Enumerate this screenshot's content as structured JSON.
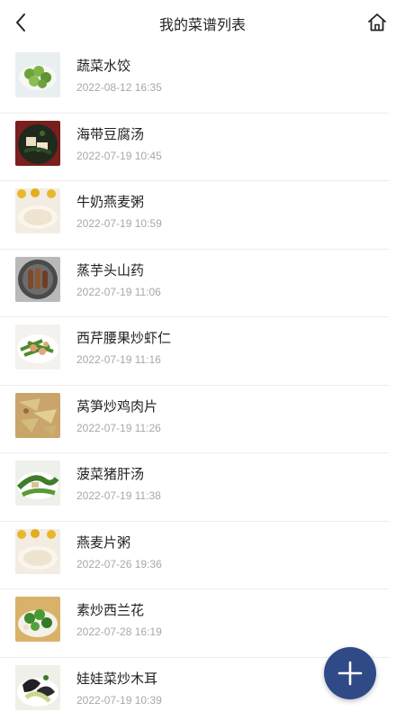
{
  "header": {
    "title": "我的菜谱列表",
    "back_icon": "chevron-left-icon",
    "home_icon": "home-icon"
  },
  "recipes": [
    {
      "name": "蔬菜水饺",
      "time": "2022-08-12 16:35"
    },
    {
      "name": "海带豆腐汤",
      "time": "2022-07-19 10:45"
    },
    {
      "name": "牛奶燕麦粥",
      "time": "2022-07-19 10:59"
    },
    {
      "name": "蒸芋头山药",
      "time": "2022-07-19 11:06"
    },
    {
      "name": "西芹腰果炒虾仁",
      "time": "2022-07-19 11:16"
    },
    {
      "name": "莴笋炒鸡肉片",
      "time": "2022-07-19 11:26"
    },
    {
      "name": "菠菜猪肝汤",
      "time": "2022-07-19 11:38"
    },
    {
      "name": "燕麦片粥",
      "time": "2022-07-26 19:36"
    },
    {
      "name": "素炒西兰花",
      "time": "2022-07-28 16:19"
    },
    {
      "name": "娃娃菜炒木耳",
      "time": "2022-07-19 10:39"
    }
  ],
  "fab": {
    "icon": "plus-icon",
    "color": "#2f4a86"
  }
}
